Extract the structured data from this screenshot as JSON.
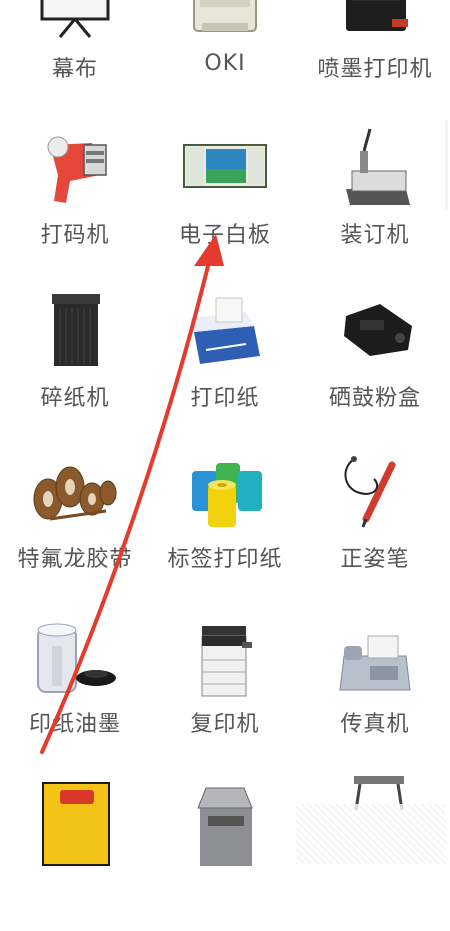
{
  "categories": [
    {
      "label": "幕布",
      "icon": "projector-screen-icon"
    },
    {
      "label": "OKI",
      "icon": "oki-printer-icon"
    },
    {
      "label": "喷墨打印机",
      "icon": "inkjet-printer-icon"
    },
    {
      "label": "打码机",
      "icon": "price-labeler-icon"
    },
    {
      "label": "电子白板",
      "icon": "electronic-whiteboard-icon"
    },
    {
      "label": "装订机",
      "icon": "binding-machine-icon"
    },
    {
      "label": "碎纸机",
      "icon": "shredder-icon"
    },
    {
      "label": "打印纸",
      "icon": "printing-paper-icon"
    },
    {
      "label": "硒鼓粉盒",
      "icon": "toner-cartridge-icon"
    },
    {
      "label": "特氟龙胶带",
      "icon": "teflon-tape-icon"
    },
    {
      "label": "标签打印纸",
      "icon": "label-roll-icon"
    },
    {
      "label": "正姿笔",
      "icon": "posture-pen-icon"
    },
    {
      "label": "印纸油墨",
      "icon": "printing-ink-icon"
    },
    {
      "label": "复印机",
      "icon": "copier-icon"
    },
    {
      "label": "传真机",
      "icon": "fax-machine-icon"
    },
    {
      "label": "",
      "icon": "sticky-notes-icon"
    },
    {
      "label": "",
      "icon": "paper-cutter-icon"
    },
    {
      "label": "",
      "icon": "laminator-icon"
    }
  ],
  "annotation": {
    "color": "#e53a2c"
  }
}
